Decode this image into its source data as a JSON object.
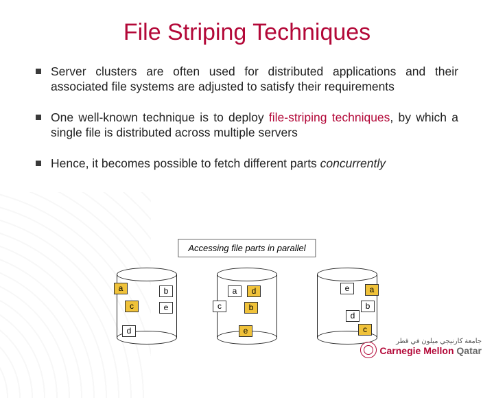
{
  "title": "File Striping Techniques",
  "bullets": {
    "b1": "Server clusters are often used for distributed applications and their associated file systems are adjusted to satisfy their requirements",
    "b2_pre": "One well-known technique is to deploy ",
    "b2_hl": "file-striping techniques",
    "b2_post": ", by which a single file is distributed across multiple servers",
    "b3_pre": "Hence, it becomes possible to fetch different parts ",
    "b3_em": "concurrently"
  },
  "caption": "Accessing file parts in parallel",
  "cyl1": {
    "r1a": "a",
    "r1b": "b",
    "r2a": "c",
    "r2b": "e",
    "r3a": "d"
  },
  "cyl2": {
    "r1a": "a",
    "r1b": "d",
    "r2a": "c",
    "r2b": "b",
    "r3a": "e"
  },
  "cyl3": {
    "r1a": "e",
    "r1b": "a",
    "r2a": "b",
    "r2b": "d",
    "r3a": "c"
  },
  "logo": {
    "arabic": "جامعة كارنيجي ميلون في قطر",
    "brand1": "Carnegie Mellon",
    "brand2": "Qatar"
  }
}
